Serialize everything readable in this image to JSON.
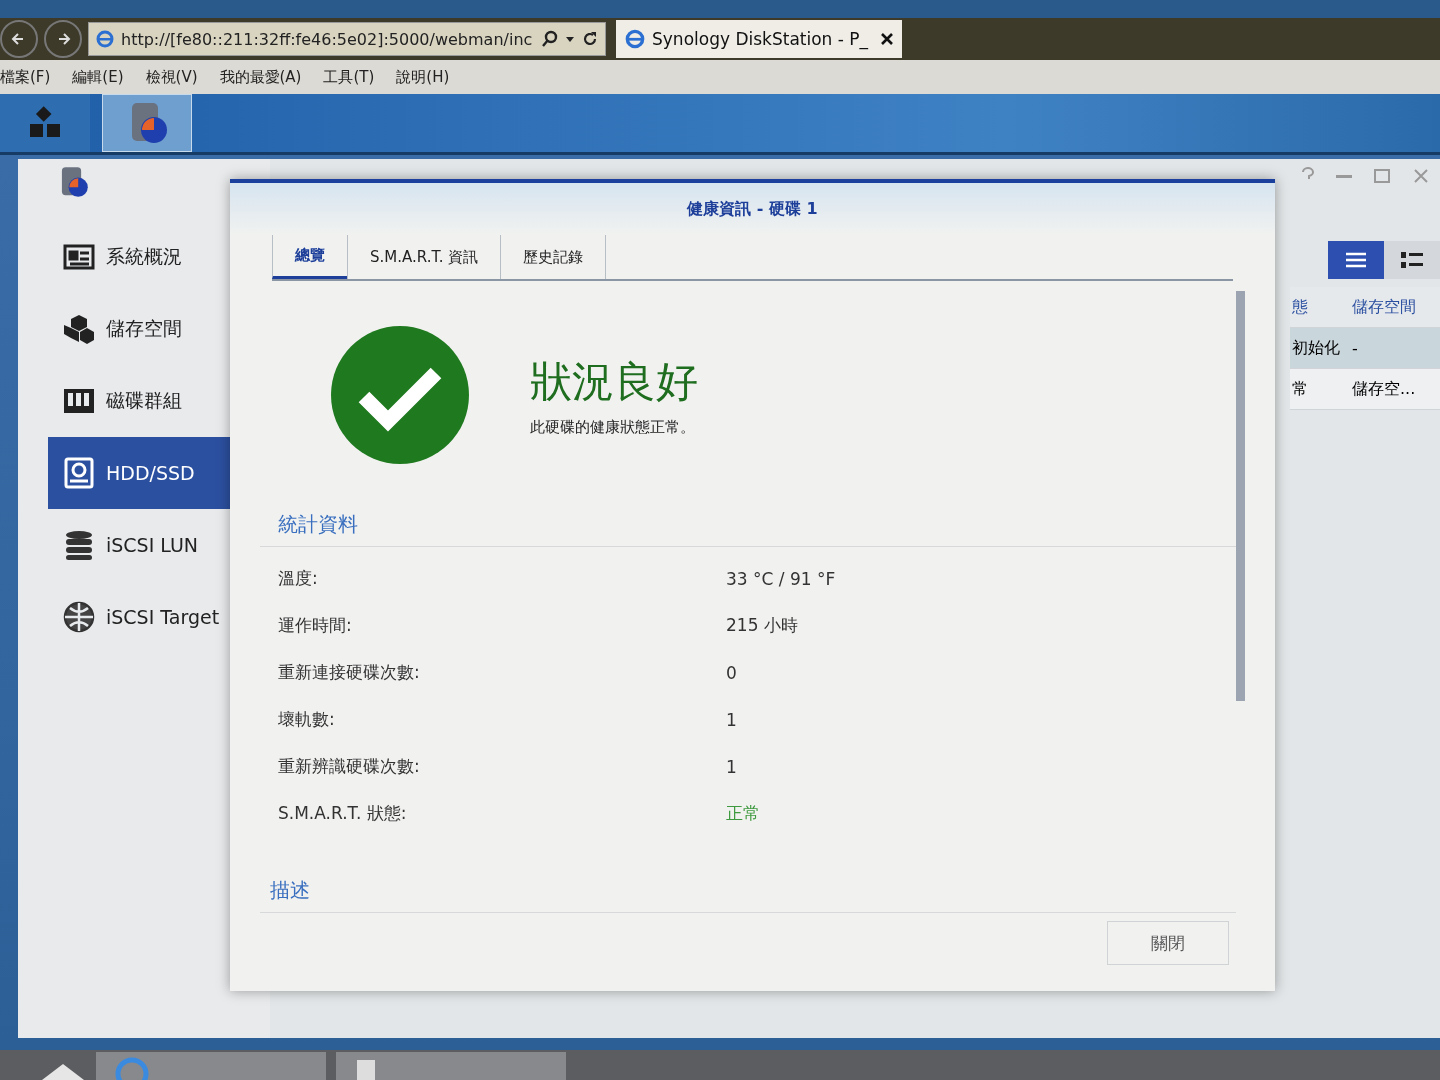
{
  "browser": {
    "address": "http://[fe80::211:32ff:fe46:5e02]:5000/webman/inc",
    "tab_title": "Synology DiskStation - P_",
    "menu": [
      "檔案(F)",
      "編輯(E)",
      "檢視(V)",
      "我的最愛(A)",
      "工具(T)",
      "說明(H)"
    ]
  },
  "dsm_taskbar": {
    "apps": [
      {
        "kind": "main-menu",
        "selected": false
      },
      {
        "kind": "storage",
        "selected": true
      }
    ]
  },
  "sidebar": {
    "items": [
      {
        "label": "系統概況",
        "selected": false
      },
      {
        "label": "儲存空間",
        "selected": false
      },
      {
        "label": "磁碟群組",
        "selected": false
      },
      {
        "label": "HDD/SSD",
        "selected": true
      },
      {
        "label": "iSCSI LUN",
        "selected": false
      },
      {
        "label": "iSCSI Target",
        "selected": false
      }
    ]
  },
  "view_toggle": [
    {
      "kind": "list",
      "selected": true
    },
    {
      "kind": "detail",
      "selected": false
    }
  ],
  "disk_table": {
    "columns": [
      "態",
      "儲存空間"
    ],
    "rows": [
      {
        "cells": [
          "初始化",
          "-"
        ],
        "selected": true
      },
      {
        "cells": [
          "常",
          "儲存空..."
        ],
        "selected": false
      }
    ]
  },
  "dialog": {
    "title": "健康資訊 - 硬碟 1",
    "tabs": [
      {
        "label": "總覽",
        "selected": true
      },
      {
        "label": "S.M.A.R.T. 資訊",
        "selected": false
      },
      {
        "label": "歷史記錄",
        "selected": false
      }
    ],
    "status": {
      "headline": "狀況良好",
      "message": "此硬碟的健康狀態正常。"
    },
    "stats_heading": "統計資料",
    "stats": [
      {
        "label": "溫度:",
        "value": "33 °C / 91 °F",
        "kind": "plain"
      },
      {
        "label": "運作時間:",
        "value": "215 小時",
        "kind": "plain"
      },
      {
        "label": "重新連接硬碟次數:",
        "value": "0",
        "kind": "plain"
      },
      {
        "label": "壞軌數:",
        "value": "1",
        "kind": "plain"
      },
      {
        "label": "重新辨識硬碟次數:",
        "value": "1",
        "kind": "plain"
      },
      {
        "label": "S.M.A.R.T. 狀態:",
        "value": "正常",
        "kind": "status"
      }
    ],
    "description_heading": "描述",
    "close_button": "關閉"
  }
}
